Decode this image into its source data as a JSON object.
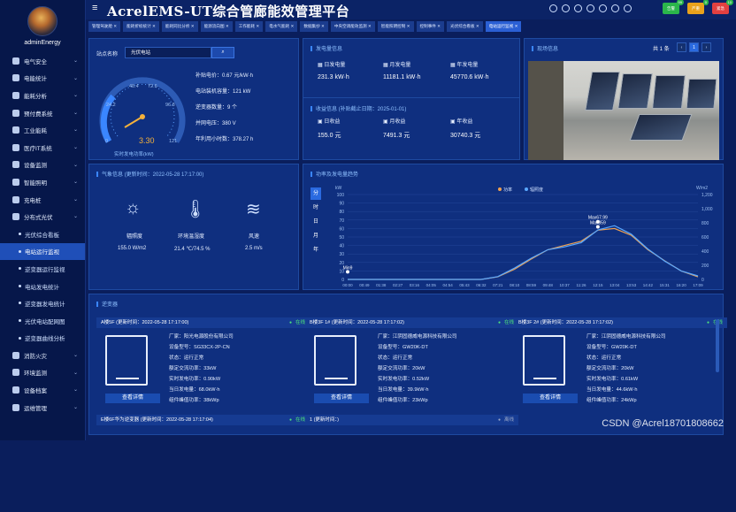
{
  "app": {
    "title": "AcrelEMS-UT综合管廊能效管理平台",
    "user": "adminEnergy"
  },
  "top_badges": [
    {
      "label": "告警",
      "count": "99",
      "color": "#2bb64b"
    },
    {
      "label": "严重",
      "count": "0",
      "color": "#e9a21c"
    },
    {
      "label": "紧急",
      "count": "10",
      "color": "#e24040"
    }
  ],
  "sidebar": [
    {
      "label": "电气安全",
      "type": "group"
    },
    {
      "label": "电能统计",
      "type": "group"
    },
    {
      "label": "能耗分析",
      "type": "group"
    },
    {
      "label": "预付费系统",
      "type": "group"
    },
    {
      "label": "工业能耗",
      "type": "group"
    },
    {
      "label": "医疗IT系统",
      "type": "group"
    },
    {
      "label": "设备监测",
      "type": "group"
    },
    {
      "label": "智能照明",
      "type": "group"
    },
    {
      "label": "充电桩",
      "type": "group"
    },
    {
      "label": "分布式光伏",
      "type": "group"
    },
    {
      "label": "光伏综合看板",
      "type": "sub"
    },
    {
      "label": "电站运行监视",
      "type": "sub",
      "active": true
    },
    {
      "label": "逆变器运行监视",
      "type": "sub"
    },
    {
      "label": "电站发电统计",
      "type": "sub"
    },
    {
      "label": "逆变器发电统计",
      "type": "sub"
    },
    {
      "label": "光伏电站配网图",
      "type": "sub"
    },
    {
      "label": "逆变器曲线分析",
      "type": "sub"
    },
    {
      "label": "消防火灾",
      "type": "group"
    },
    {
      "label": "环境监测",
      "type": "group"
    },
    {
      "label": "设备档案",
      "type": "group"
    },
    {
      "label": "运维管理",
      "type": "group"
    }
  ],
  "tabs": [
    "管理驾驶舱",
    "能耗折标统计",
    "能耗同比分析",
    "能源流向图",
    "工作能耗",
    "电水气能耗",
    "数据集抄",
    "中央空调能效监测",
    "智能照明控制",
    "控制事件",
    "光伏综合看板",
    "电站运行监视"
  ],
  "station": {
    "label": "站点名称",
    "value": "光伏电站",
    "search_icon": "search-icon",
    "gauge": {
      "value": "3.30",
      "caption": "实时发电功率(kW)",
      "scale": [
        "0",
        "24.2",
        "48.4",
        "72.6",
        "96.8",
        "121"
      ]
    },
    "info": [
      "补贴电价：0.67 元/kW·h",
      "电站装机容量：121 kW",
      "逆变器数量：9 个",
      "并网电压：380 V",
      "年利用小时数：378.27 h"
    ]
  },
  "generation": {
    "title": "发电量信息",
    "items": [
      {
        "label": "日发电量",
        "value": "231.3 kW·h"
      },
      {
        "label": "月发电量",
        "value": "11181.1 kW·h"
      },
      {
        "label": "年发电量",
        "value": "45770.6 kW·h"
      }
    ]
  },
  "revenue": {
    "title": "收益信息",
    "note": "(补贴截止日期：2025-01-01)",
    "items": [
      {
        "label": "日收益",
        "value": "155.0 元"
      },
      {
        "label": "月收益",
        "value": "7491.3 元"
      },
      {
        "label": "年收益",
        "value": "30740.3 元"
      }
    ]
  },
  "photo": {
    "title": "现场信息",
    "total": "共 1 条",
    "page": "1"
  },
  "weather": {
    "title": "气象信息 (更新时间：2022-05-28 17:17:00)",
    "items": [
      {
        "label": "辐照度",
        "value": "155.0 W/m2"
      },
      {
        "label": "环境温湿度",
        "value": "21.4 ℃/74.5 %"
      },
      {
        "label": "风速",
        "value": "2.5 m/s"
      }
    ]
  },
  "power_chart": {
    "title": "功率及发电量趋势",
    "period_tabs": [
      "分",
      "时",
      "日",
      "月",
      "年"
    ],
    "active_tab": "分"
  },
  "chart_data": {
    "type": "line",
    "ylabel": "kW",
    "y2label": "W/m2",
    "ylim": [
      0,
      100
    ],
    "y2lim": [
      0,
      1200
    ],
    "yticks": [
      "0",
      "10",
      "20",
      "30",
      "40",
      "50",
      "60",
      "70",
      "80",
      "90",
      "100"
    ],
    "y2ticks": [
      "0",
      "200",
      "400",
      "600",
      "800",
      "1,000",
      "1,200"
    ],
    "categories": [
      "00:00",
      "00:49",
      "01:38",
      "02:27",
      "03:16",
      "04:05",
      "04:54",
      "05:43",
      "06:32",
      "07:21",
      "08:10",
      "08:59",
      "09:48",
      "10:37",
      "11:26",
      "12:15",
      "13:04",
      "13:53",
      "14:42",
      "15:31",
      "16:20",
      "17:09"
    ],
    "series": [
      {
        "name": "功率",
        "color": "#f0a050",
        "axis": "left",
        "values": [
          0,
          0,
          0,
          0,
          0,
          0,
          0,
          0,
          0,
          3,
          12,
          24,
          35,
          40,
          45,
          58,
          60,
          52,
          35,
          22,
          10,
          3
        ]
      },
      {
        "name": "辐照度",
        "color": "#5aa8ff",
        "axis": "right",
        "values": [
          0,
          0,
          0,
          0,
          0,
          0,
          0,
          0,
          0,
          40,
          160,
          300,
          420,
          460,
          520,
          700,
          760,
          640,
          430,
          260,
          120,
          50
        ]
      }
    ],
    "annotations": [
      {
        "text": "Max67.99",
        "x": "12:15",
        "y": 67.99
      },
      {
        "text": "Max859",
        "x": "12:15",
        "y": 62
      },
      {
        "text": "Min9",
        "x": "00:00",
        "y": 9
      }
    ],
    "legend": "top-center"
  },
  "inverters": {
    "title": "逆变器",
    "items": [
      {
        "name": "A楼5F (更新时间：2022-05-28 17:17:00)",
        "status": "在线",
        "details": [
          "厂家：阳光电源股份有限公司",
          "设备型号：SG33CX-2P-CN",
          "状态：运行正常",
          "额定交流功率：33kW",
          "实时发电功率：0.90kW",
          "当日发电量：68.0kW·h",
          "组件峰值功率：38kWp"
        ],
        "button": "查看详情"
      },
      {
        "name": "B楼3F 1# (更新时间：2022-05-28 17:17:02)",
        "status": "在线",
        "details": [
          "厂家：江阴固德威电源科技有限公司",
          "设备型号：GW20K-DT",
          "状态：运行正常",
          "额定交流功率：20kW",
          "实时发电功率：0.52kW",
          "当日发电量：39.9kW·h",
          "组件峰值功率：23kWp"
        ],
        "button": "查看详情"
      },
      {
        "name": "B楼3F 2# (更新时间：2022-05-28 17:17:02)",
        "status": "在线",
        "details": [
          "厂家：江阴固德威电源科技有限公司",
          "设备型号：GW20K-DT",
          "状态：运行正常",
          "额定交流功率：20kW",
          "实时发电功率：0.61kW",
          "当日发电量：44.6kW·h",
          "组件峰值功率：24kWp"
        ],
        "button": "查看详情"
      },
      {
        "name": "E楼6F华为逆变器 (更新时间：2022-05-28 17:17:04)",
        "status": "在线"
      },
      {
        "name": "1 (更新时间：)",
        "status": "离线"
      }
    ]
  },
  "watermark": "CSDN @Acrel18701808662"
}
